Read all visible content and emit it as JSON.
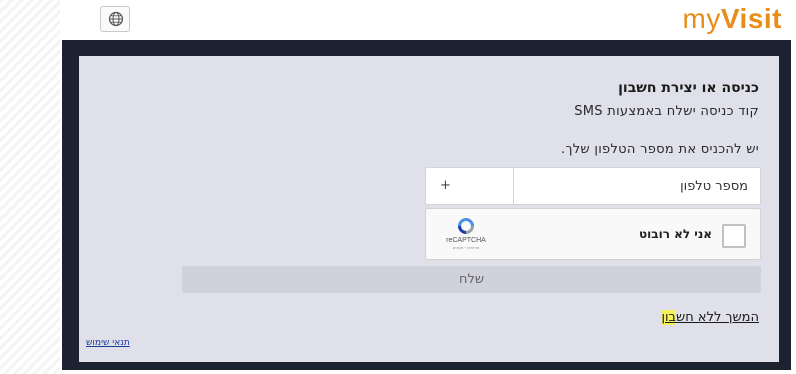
{
  "header": {
    "language_icon": "globe-chat-icon",
    "logo": {
      "part1": "my",
      "part2": "Visit"
    },
    "logo_color": "#e88c1a"
  },
  "form": {
    "title": "כניסה או יצירת חשבון",
    "subtitle": "קוד כניסה ישלח באמצעות SMS",
    "instruction": "יש להכניס את מספר הטלפון שלך.",
    "phone": {
      "country_code": "+",
      "placeholder": "מספר טלפון",
      "value": ""
    },
    "recaptcha": {
      "label": "אני לא רובוט",
      "brand": "reCAPTCHA",
      "terms": "פרטיות - תנאים",
      "checked": false
    },
    "submit_label": "שלח",
    "continue_link": {
      "text_before": "המשך ללא חש",
      "text_highlight": "בון"
    },
    "terms_link": "תנאי שימוש"
  },
  "colors": {
    "frame": "#1c2230",
    "card": "#dfe0e9",
    "button": "#d0d1da",
    "link": "#1b3c9b",
    "highlight": "#f4f25a"
  }
}
